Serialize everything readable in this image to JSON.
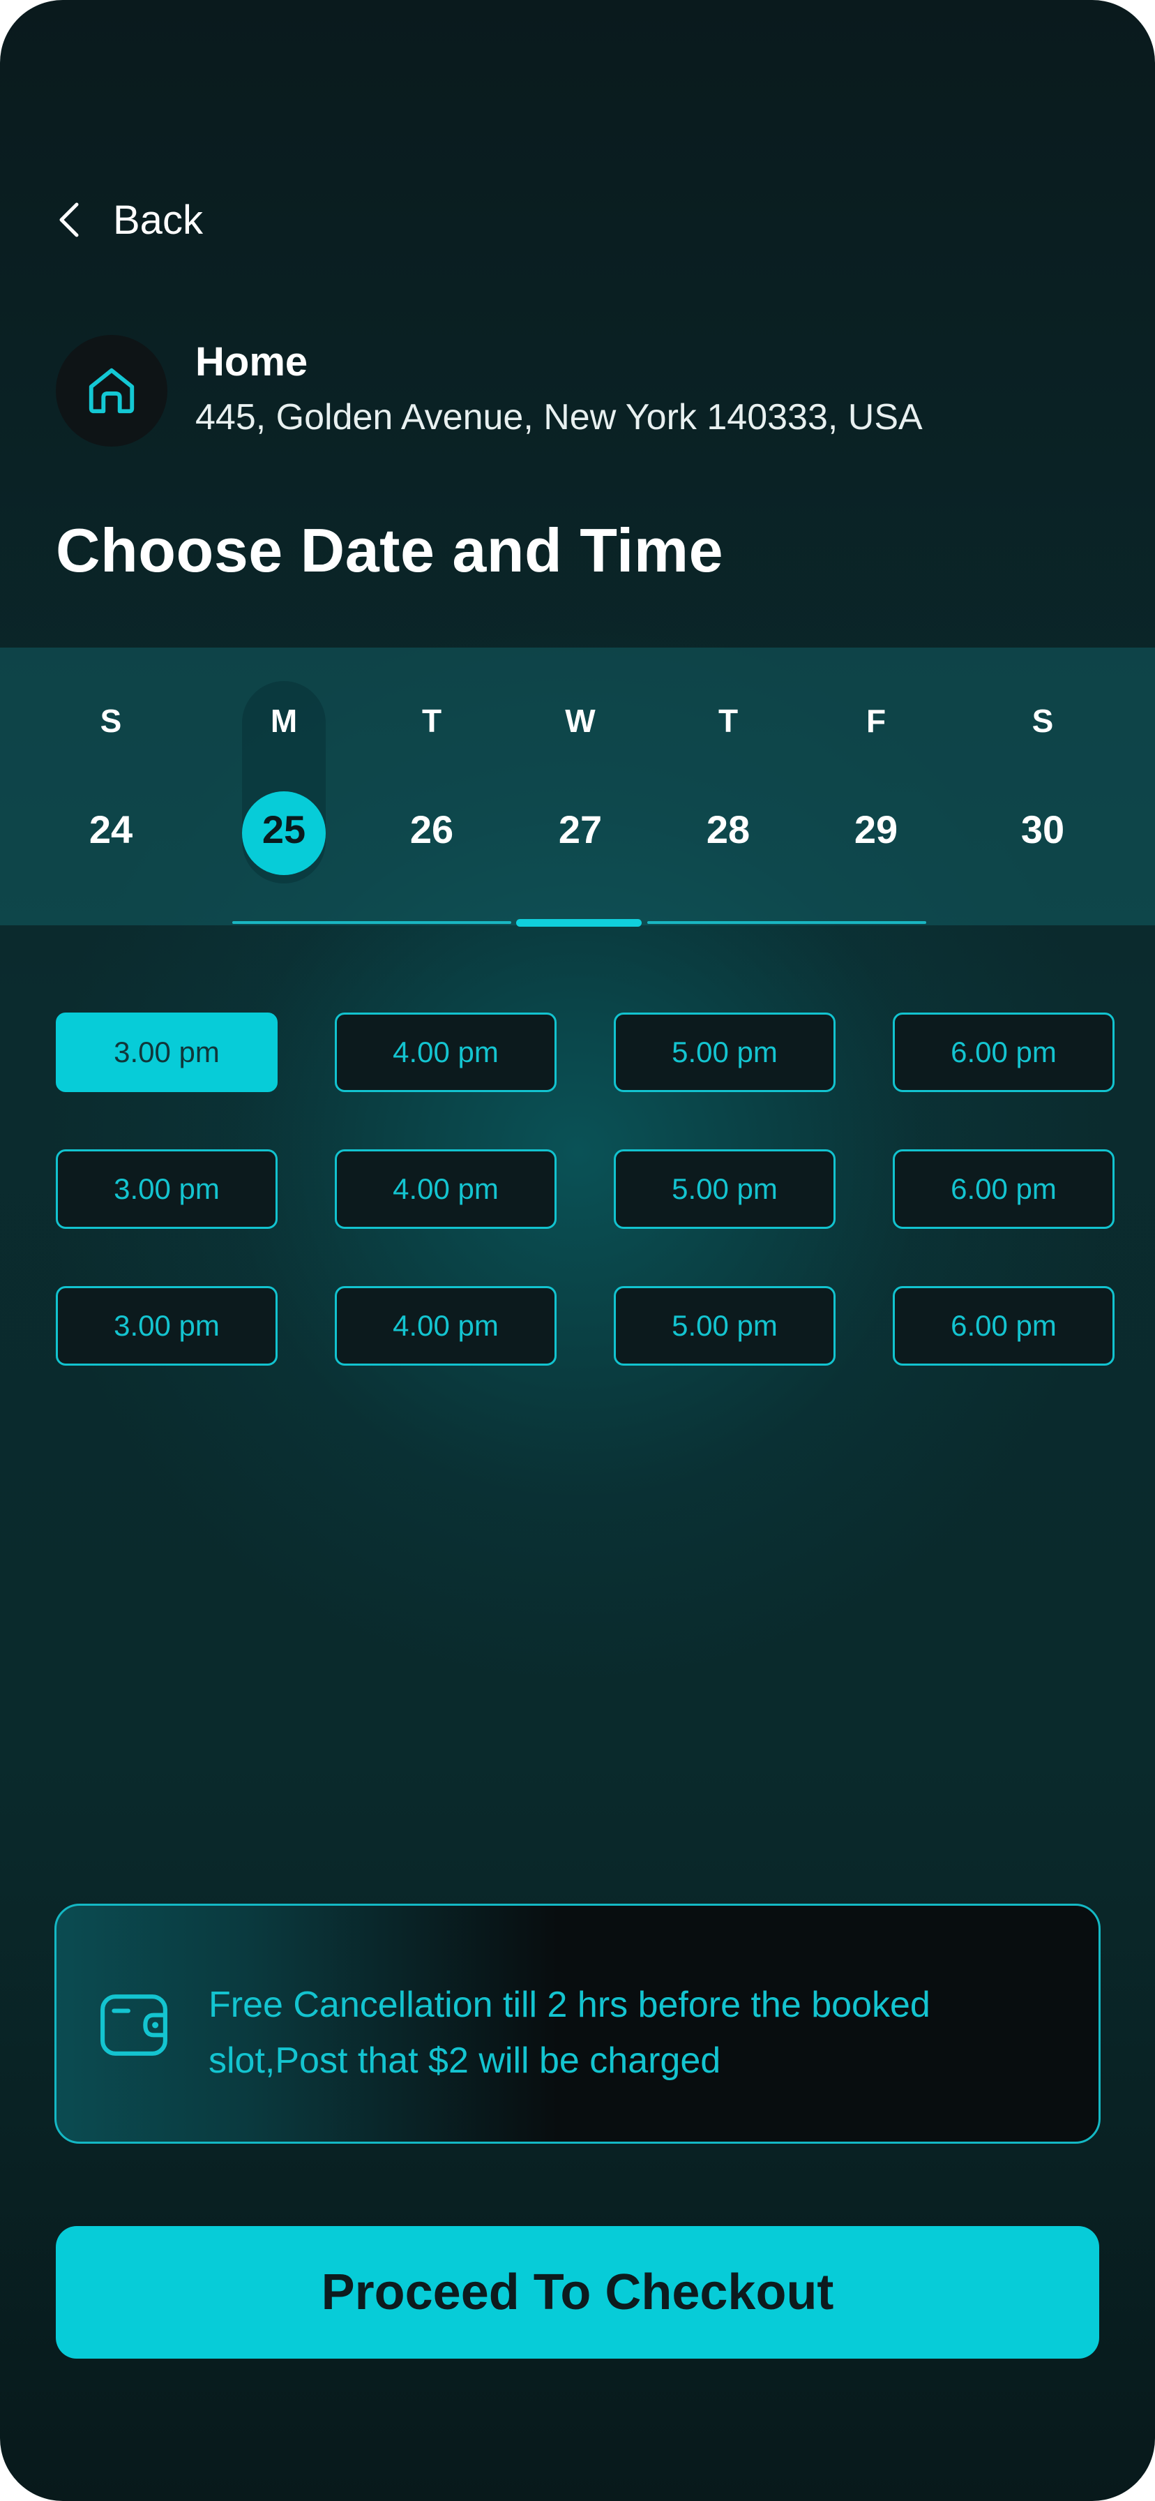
{
  "nav": {
    "back_label": "Back"
  },
  "address": {
    "title": "Home",
    "line": "445, Golden Avenue, New York 140333, USA"
  },
  "page": {
    "title": "Choose Date and Time"
  },
  "calendar": {
    "selected_index": 1,
    "days": [
      {
        "letter": "S",
        "date": "24"
      },
      {
        "letter": "M",
        "date": "25"
      },
      {
        "letter": "T",
        "date": "26"
      },
      {
        "letter": "W",
        "date": "27"
      },
      {
        "letter": "T",
        "date": "28"
      },
      {
        "letter": "F",
        "date": "29"
      },
      {
        "letter": "S",
        "date": "30"
      }
    ]
  },
  "slots": {
    "rows": [
      [
        "3.00 pm",
        "4.00 pm",
        "5.00 pm",
        "6.00 pm"
      ],
      [
        "3.00 pm",
        "4.00 pm",
        "5.00 pm",
        "6.00 pm"
      ],
      [
        "3.00 pm",
        "4.00 pm",
        "5.00 pm",
        "6.00 pm"
      ]
    ],
    "selected": "row 1, slot 1"
  },
  "info": {
    "icon": "wallet-icon",
    "text": "Free Cancellation till 2 hrs before the booked slot,Post that $2 will be charged"
  },
  "checkout": {
    "label": "Proceed To Checkout"
  },
  "colors": {
    "accent": "#07ccd8",
    "background": "#0a2a2c",
    "text": "#ffffff"
  }
}
